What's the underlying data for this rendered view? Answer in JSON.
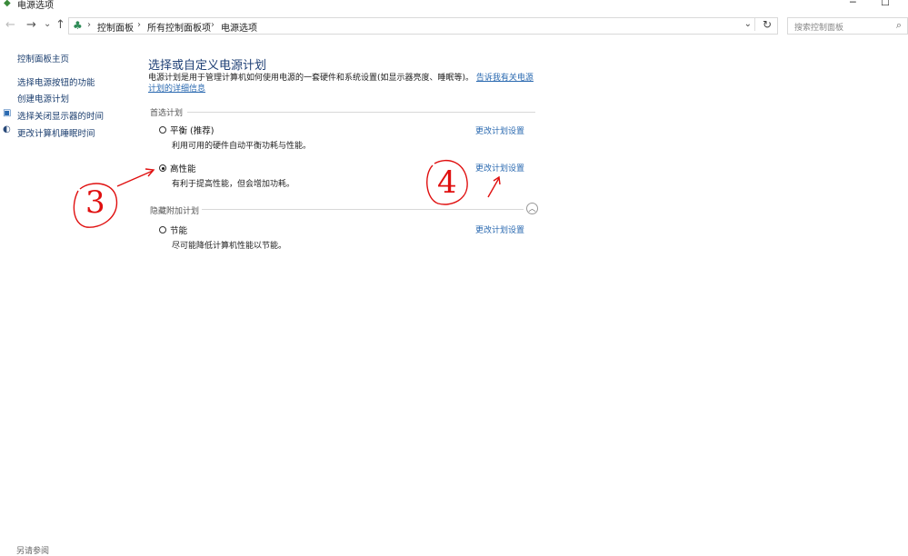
{
  "window": {
    "title": "电源选项",
    "minimize": "─",
    "maximize": "☐"
  },
  "address": {
    "back": "←",
    "forward": "→",
    "history": "⌄",
    "up": "↑",
    "crumbs": [
      "控制面板",
      "所有控制面板项",
      "电源选项"
    ],
    "separator": "›",
    "dropdown": "⌄",
    "refresh": "↻"
  },
  "search": {
    "placeholder": "搜索控制面板",
    "icon": "⌕"
  },
  "left_nav": {
    "items": [
      {
        "label": "控制面板主页",
        "icon": ""
      },
      {
        "label": "选择电源按钮的功能",
        "icon": ""
      },
      {
        "label": "创建电源计划",
        "icon": ""
      },
      {
        "label": "选择关闭显示器的时间",
        "icon": "🖥"
      },
      {
        "label": "更改计算机睡眠时间",
        "icon": "◐"
      }
    ]
  },
  "main": {
    "heading": "选择或自定义电源计划",
    "description": "电源计划是用于管理计算机如何使用电源的一套硬件和系统设置(如显示器亮度、睡眠等)。",
    "learn_more": "告诉我有关电源计划的详细信息",
    "preferred_section": "首选计划",
    "hidden_section": "隐藏附加计划",
    "collapse_icon": "︿",
    "plans": [
      {
        "name": "平衡 (推荐)",
        "description": "利用可用的硬件自动平衡功耗与性能。",
        "selected": false,
        "change_link": "更改计划设置"
      },
      {
        "name": "高性能",
        "description": "有利于提高性能，但会增加功耗。",
        "selected": true,
        "change_link": "更改计划设置"
      },
      {
        "name": "节能",
        "description": "尽可能降低计算机性能以节能。",
        "selected": false,
        "change_link": "更改计划设置"
      }
    ]
  },
  "annotations": {
    "three": "3",
    "four": "4"
  },
  "footer": {
    "label": "另请参阅"
  }
}
